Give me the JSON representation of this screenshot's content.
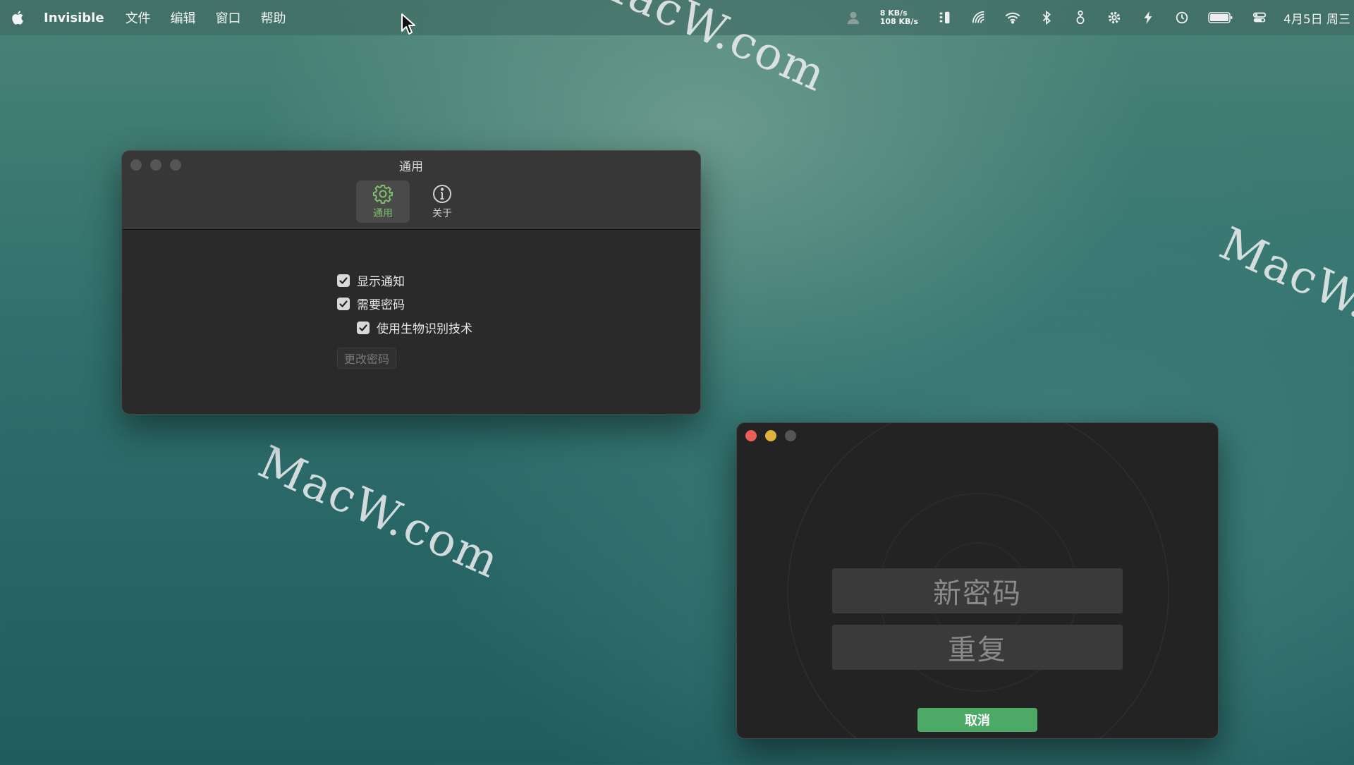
{
  "menubar": {
    "app_name": "Invisible",
    "items": [
      "文件",
      "编辑",
      "窗口",
      "帮助"
    ],
    "net_up": "8 KB/s",
    "net_down": "108 KB/s",
    "datetime": "4月5日 周三"
  },
  "watermark_text": "MacW.com",
  "prefs_window": {
    "title": "通用",
    "tabs": [
      {
        "label": "通用",
        "icon": "gear-icon",
        "active": true
      },
      {
        "label": "关于",
        "icon": "info-icon",
        "active": false
      }
    ],
    "options": [
      {
        "label": "显示通知",
        "checked": true
      },
      {
        "label": "需要密码",
        "checked": true
      },
      {
        "label": "使用生物识别技术",
        "checked": true
      }
    ],
    "change_password_label": "更改密码"
  },
  "password_window": {
    "new_password_placeholder": "新密码",
    "repeat_placeholder": "重复",
    "cancel_label": "取消"
  },
  "colors": {
    "accent_green": "#4caa66",
    "active_tab_text": "#7fbf6a"
  }
}
